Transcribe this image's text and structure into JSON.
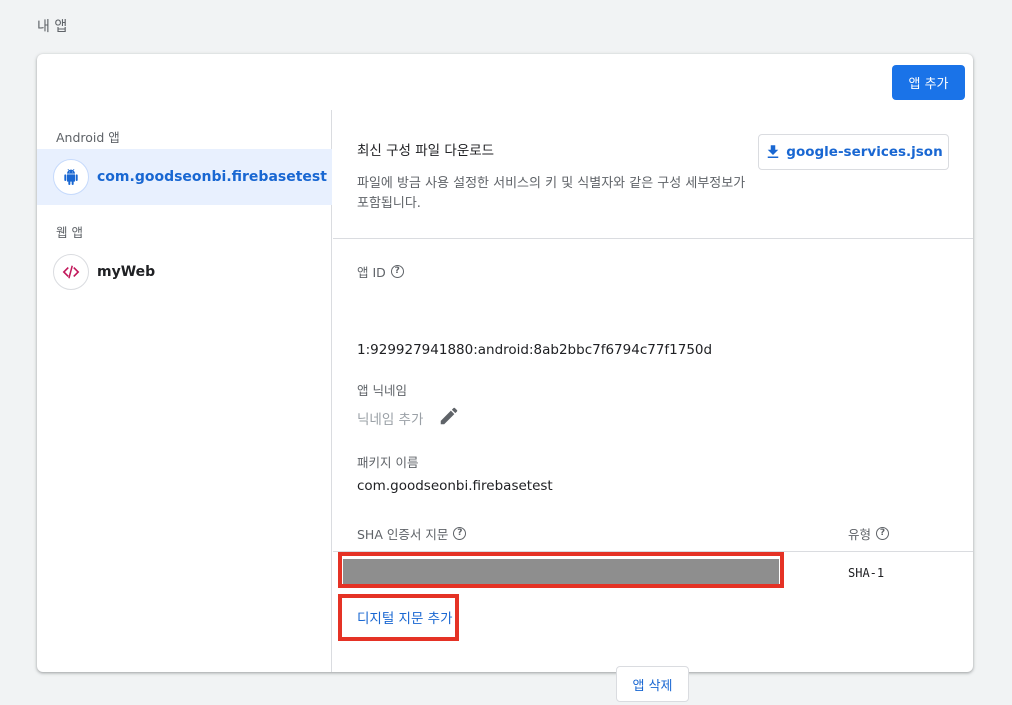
{
  "page": {
    "section_title": "내 앱"
  },
  "header": {
    "add_app_label": "앱 추가"
  },
  "sidebar": {
    "android_group_label": "Android 앱",
    "android_apps": [
      {
        "name": "com.goodseonbi.firebasetest",
        "icon": "android-icon",
        "selected": true
      }
    ],
    "web_group_label": "웹 앱",
    "web_apps": [
      {
        "name": "myWeb",
        "icon": "code-icon",
        "selected": false
      }
    ]
  },
  "config": {
    "title": "최신 구성 파일 다운로드",
    "description": "파일에 방금 사용 설정한 서비스의 키 및 식별자와 같은 구성 세부정보가 포함됩니다.",
    "download_label": "google-services.json",
    "download_icon": "download-icon"
  },
  "details": {
    "app_id_label": "앱 ID",
    "app_id_value": "1:929927941880:android:8ab2bbc7f6794c77f1750d",
    "nickname_label": "앱 닉네임",
    "nickname_placeholder": "닉네임 추가",
    "package_label": "패키지 이름",
    "package_value": "com.goodseonbi.firebasetest",
    "sha_label": "SHA 인증서 지문",
    "type_label": "유형",
    "fingerprints": [
      {
        "value": "",
        "type": "SHA-1"
      }
    ],
    "add_fingerprint_label": "디지털 지문 추가",
    "delete_app_label": "앱 삭제"
  },
  "colors": {
    "accent": "#1a73e8",
    "link": "#1967d2",
    "selected_bg": "#e8f0fe",
    "highlight": "#e53225",
    "web_icon": "#c2185b"
  }
}
